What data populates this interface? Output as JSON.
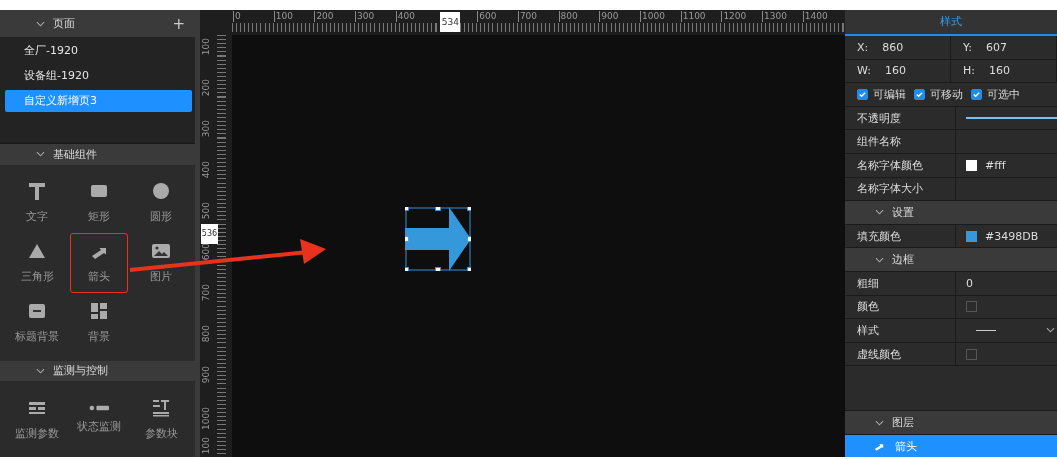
{
  "pages": {
    "title": "页面",
    "add": "+",
    "expanded": true,
    "items": [
      {
        "label": "全厂-1920",
        "selected": false
      },
      {
        "label": "设备组-1920",
        "selected": false
      },
      {
        "label": "自定义新增页3",
        "selected": true
      }
    ]
  },
  "component_groups": [
    {
      "title": "基础组件",
      "expanded": true,
      "items": [
        {
          "kind": "text",
          "label": "文字",
          "highlighted": false
        },
        {
          "kind": "rect",
          "label": "矩形",
          "highlighted": false
        },
        {
          "kind": "circle",
          "label": "圆形",
          "highlighted": false
        },
        {
          "kind": "triangle",
          "label": "三角形",
          "highlighted": false
        },
        {
          "kind": "arrow",
          "label": "箭头",
          "highlighted": true
        },
        {
          "kind": "image",
          "label": "图片",
          "highlighted": false
        },
        {
          "kind": "title_bg",
          "label": "标题背景",
          "highlighted": false
        },
        {
          "kind": "background",
          "label": "背景",
          "highlighted": false
        }
      ]
    },
    {
      "title": "监测与控制",
      "expanded": true,
      "items": [
        {
          "kind": "params",
          "label": "监测参数",
          "highlighted": false
        },
        {
          "kind": "status",
          "label": "状态监测",
          "highlighted": false
        },
        {
          "kind": "block",
          "label": "参数块",
          "highlighted": false
        }
      ]
    }
  ],
  "callout_arrow": true,
  "horizontal_ruler": {
    "labels": [
      "0",
      "100",
      "200",
      "300",
      "400",
      "600",
      "700",
      "800",
      "900",
      "1000",
      "1100",
      "1200",
      "1300",
      "1400"
    ],
    "marker": "534"
  },
  "vertical_ruler": {
    "labels": [
      "100",
      "200",
      "300",
      "400",
      "500",
      "600",
      "700",
      "800",
      "900",
      "1000",
      "100"
    ],
    "marker": "536"
  },
  "canvas": {
    "element": {
      "kind": "arrow",
      "selected": true
    }
  },
  "style_panel": {
    "title": "样式",
    "rows": [
      {
        "kind": "pair",
        "cells": [
          {
            "label": "X:",
            "value": "860"
          },
          {
            "label": "Y:",
            "value": "607"
          }
        ]
      },
      {
        "kind": "pair",
        "cells": [
          {
            "label": "W:",
            "value": "160"
          },
          {
            "label": "H:",
            "value": "160"
          }
        ]
      },
      {
        "kind": "checks",
        "items": [
          {
            "label": "可编辑",
            "checked": true
          },
          {
            "label": "可移动",
            "checked": true
          },
          {
            "label": "可选中",
            "checked": true
          }
        ]
      },
      {
        "kind": "slider",
        "label": "不透明度",
        "level": 1
      },
      {
        "kind": "text",
        "label": "组件名称"
      },
      {
        "kind": "color",
        "label": "名称字体颜色",
        "color": "#ffffff",
        "value": "#fff"
      },
      {
        "kind": "text",
        "label": "名称字体大小"
      },
      {
        "kind": "section",
        "label": "设置",
        "expanded": true
      },
      {
        "kind": "color",
        "label": "填充颜色",
        "color": "#3498db",
        "value": "#3498DB"
      },
      {
        "kind": "section",
        "label": "边框",
        "expanded": true
      },
      {
        "kind": "text",
        "label": "粗细",
        "value": "0"
      },
      {
        "kind": "color",
        "label": "颜色"
      },
      {
        "kind": "line_style",
        "label": "样式"
      },
      {
        "kind": "color",
        "label": "虚线颜色"
      }
    ]
  },
  "layers": {
    "title": "图层",
    "expanded": true,
    "items": [
      {
        "label": "箭头",
        "selected": true
      }
    ]
  }
}
